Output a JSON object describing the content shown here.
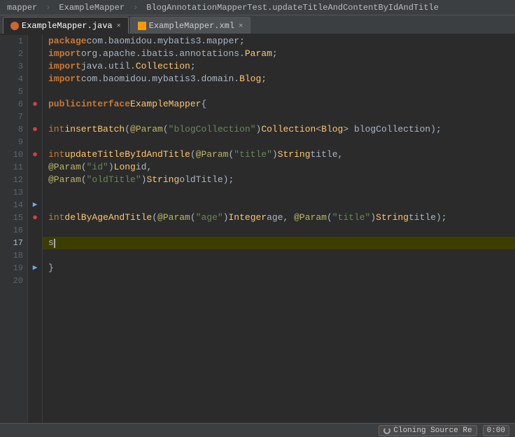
{
  "topBar": {
    "items": [
      "mapper",
      "ExampleMapper",
      "BlogAnnotationMapperTest.updateTitleAndContentByIdAndTitle"
    ]
  },
  "tabs": [
    {
      "id": "java",
      "label": "ExampleMapper.java",
      "active": true,
      "iconType": "java"
    },
    {
      "id": "xml",
      "label": "ExampleMapper.xml",
      "active": false,
      "iconType": "xml"
    }
  ],
  "lines": [
    {
      "num": 1,
      "marker": "",
      "content": "package com.baomidou.mybatis3.mapper;",
      "highlight": false
    },
    {
      "num": 2,
      "marker": "",
      "content": "import org.apache.ibatis.annotations.Param;",
      "highlight": false
    },
    {
      "num": 3,
      "marker": "",
      "content": "import java.util.Collection;",
      "highlight": false
    },
    {
      "num": 4,
      "marker": "",
      "content": "import com.baomidou.mybatis3.domain.Blog;",
      "highlight": false
    },
    {
      "num": 5,
      "marker": "",
      "content": "",
      "highlight": false
    },
    {
      "num": 6,
      "marker": "red",
      "content": "public interface ExampleMapper  {",
      "highlight": false
    },
    {
      "num": 7,
      "marker": "",
      "content": "",
      "highlight": false
    },
    {
      "num": 8,
      "marker": "red",
      "content": "    int insertBatch(@Param(\"blogCollection\") Collection<Blog> blogCollection);",
      "highlight": false
    },
    {
      "num": 9,
      "marker": "",
      "content": "",
      "highlight": false
    },
    {
      "num": 10,
      "marker": "red",
      "content": "    int updateTitleByIdAndTitle(@Param(\"title\") String title,",
      "highlight": false
    },
    {
      "num": 11,
      "marker": "",
      "content": "                                @Param(\"id\") Long id,",
      "highlight": false
    },
    {
      "num": 12,
      "marker": "",
      "content": "                                @Param(\"oldTitle\") String oldTitle);",
      "highlight": false
    },
    {
      "num": 13,
      "marker": "",
      "content": "",
      "highlight": false
    },
    {
      "num": 14,
      "marker": "arrow",
      "content": "",
      "highlight": false
    },
    {
      "num": 15,
      "marker": "red",
      "content": "    int delByAgeAndTitle(@Param(\"age\") Integer age, @Param(\"title\") String title);",
      "highlight": false
    },
    {
      "num": 16,
      "marker": "",
      "content": "",
      "highlight": false
    },
    {
      "num": 17,
      "marker": "",
      "content": "    s",
      "highlight": true,
      "cursor": true
    },
    {
      "num": 18,
      "marker": "",
      "content": "",
      "highlight": false
    },
    {
      "num": 19,
      "marker": "arrow",
      "content": "}",
      "highlight": false
    },
    {
      "num": 20,
      "marker": "",
      "content": "",
      "highlight": false
    }
  ],
  "statusBar": {
    "cloningLabel": "Cloning Source Re",
    "timeLabel": "0:00"
  }
}
